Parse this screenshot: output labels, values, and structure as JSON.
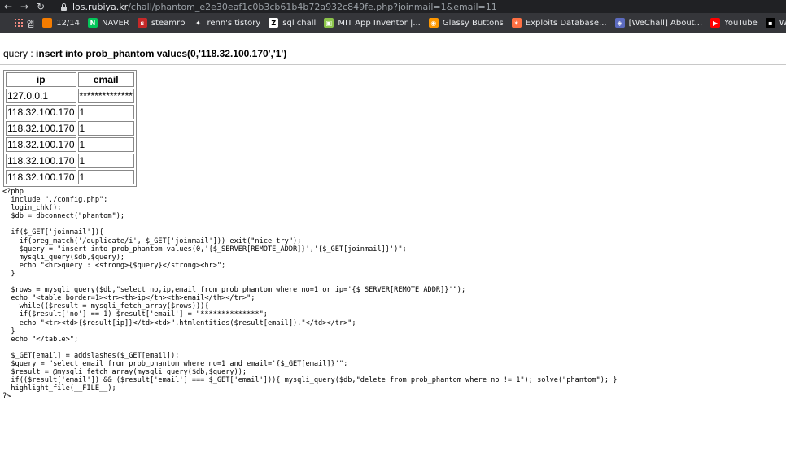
{
  "browser": {
    "url_host": "los.rubiya.kr",
    "url_path": "/chall/phantom_e2e30eaf1c0b3cb61b4b72a932c849fe.php?joinmail=1&email=11",
    "bookmarks": [
      {
        "label": "앱",
        "icon": "apps-grid-icon",
        "color": "#f28b82"
      },
      {
        "label": "12/14",
        "icon": "blogger-icon",
        "color": "#f57c00"
      },
      {
        "label": "NAVER",
        "icon": "naver-icon",
        "color": "#03c75a",
        "glyph": "N"
      },
      {
        "label": "steamrp",
        "icon": "steam-icon",
        "color": "#c62828",
        "glyph": "s"
      },
      {
        "label": "renn's tistory",
        "icon": "tistory-icon",
        "color": "#35363a",
        "glyph": "✦"
      },
      {
        "label": "sql chall",
        "icon": "z-icon",
        "color": "#ffffff",
        "glyph": "Z"
      },
      {
        "label": "MIT App Inventor |...",
        "icon": "app-inventor-icon",
        "color": "#8bc34a",
        "glyph": "▣"
      },
      {
        "label": "Glassy Buttons",
        "icon": "glassy-buttons-icon",
        "color": "#ff9800",
        "glyph": "◉"
      },
      {
        "label": "Exploits Database...",
        "icon": "exploit-db-icon",
        "color": "#ff7043",
        "glyph": "✶"
      },
      {
        "label": "[WeChall] About...",
        "icon": "wechall-icon",
        "color": "#5c6bc0",
        "glyph": "◈"
      },
      {
        "label": "YouTube",
        "icon": "youtube-icon",
        "color": "#ff0000",
        "glyph": "▶"
      },
      {
        "label": "Whats My IP Addr...",
        "icon": "whatsmyip-icon",
        "color": "#000000",
        "glyph": "▪"
      }
    ]
  },
  "page": {
    "query_label": "query : ",
    "query_text": "insert into prob_phantom values(0,'118.32.100.170','1')",
    "table": {
      "headers": [
        "ip",
        "email"
      ],
      "rows": [
        [
          "127.0.0.1",
          "**************"
        ],
        [
          "118.32.100.170",
          "1"
        ],
        [
          "118.32.100.170",
          "1"
        ],
        [
          "118.32.100.170",
          "1"
        ],
        [
          "118.32.100.170",
          "1"
        ],
        [
          "118.32.100.170",
          "1"
        ]
      ]
    },
    "source_lines": [
      "<?php",
      "  include \"./config.php\";",
      "  login_chk();",
      "  $db = dbconnect(\"phantom\");",
      "",
      "  if($_GET['joinmail']){",
      "    if(preg_match('/duplicate/i', $_GET['joinmail'])) exit(\"nice try\");",
      "    $query = \"insert into prob_phantom values(0,'{$_SERVER[REMOTE_ADDR]}','{$_GET[joinmail]}')\";",
      "    mysqli_query($db,$query);",
      "    echo \"<hr>query : <strong>{$query}</strong><hr>\";",
      "  }",
      "",
      "  $rows = mysqli_query($db,\"select no,ip,email from prob_phantom where no=1 or ip='{$_SERVER[REMOTE_ADDR]}'\");",
      "  echo \"<table border=1><tr><th>ip</th><th>email</th></tr>\";",
      "    while(($result = mysqli_fetch_array($rows))){",
      "    if($result['no'] == 1) $result['email'] = \"**************\";",
      "    echo \"<tr><td>{$result[ip]}</td><td>\".htmlentities($result[email]).\"</td></tr>\";",
      "  }",
      "  echo \"</table>\";",
      "",
      "  $_GET[email] = addslashes($_GET[email]);",
      "  $query = \"select email from prob_phantom where no=1 and email='{$_GET[email]}'\";",
      "  $result = @mysqli_fetch_array(mysqli_query($db,$query));",
      "  if(($result['email']) && ($result['email'] === $_GET['email'])){ mysqli_query($db,\"delete from prob_phantom where no != 1\"); solve(\"phantom\"); }",
      "  highlight_file(__FILE__);",
      "?>"
    ]
  }
}
